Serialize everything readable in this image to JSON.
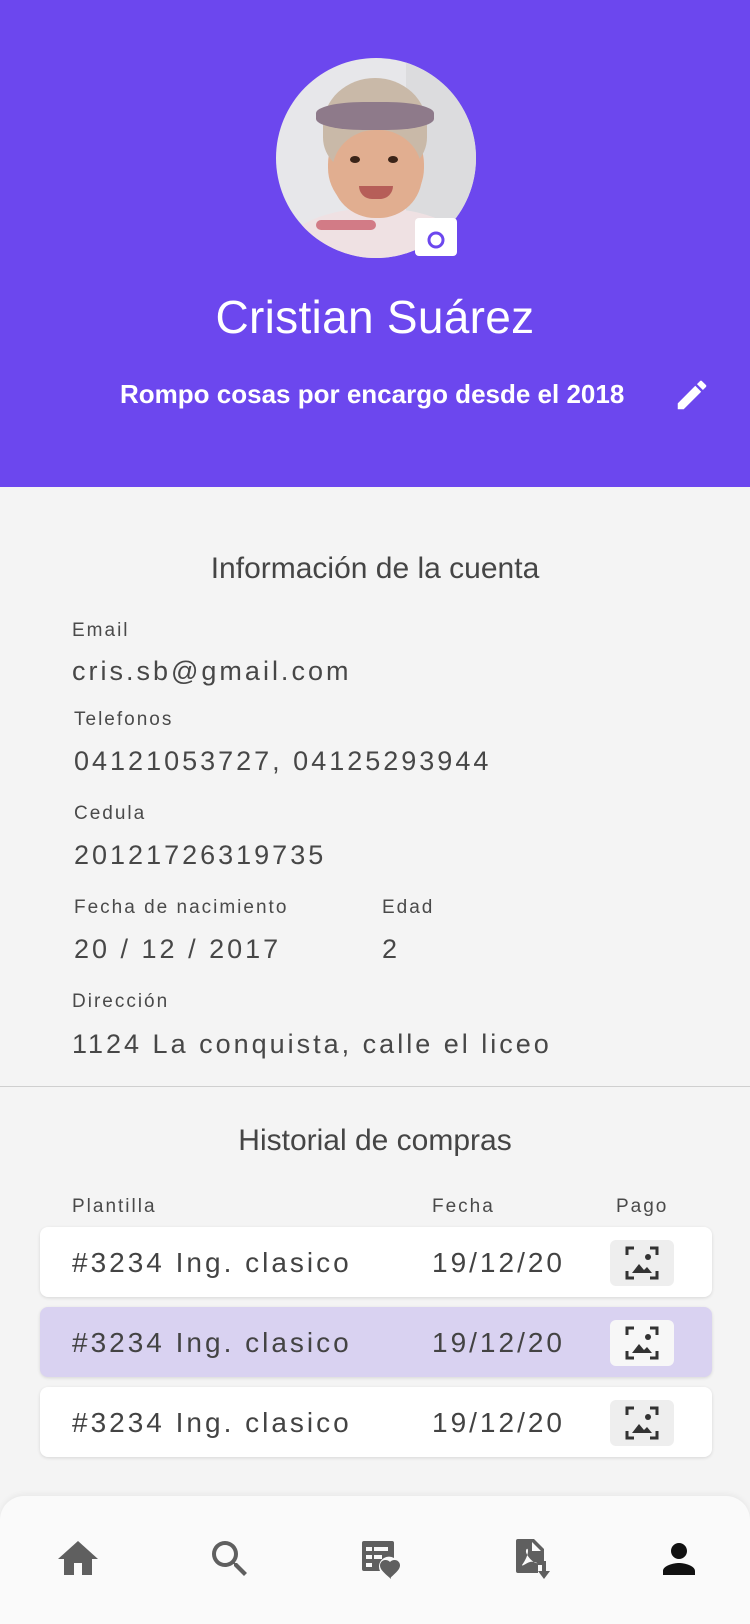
{
  "profile": {
    "name": "Cristian Suárez",
    "bio": "Rompo cosas por encargo desde el 2018"
  },
  "account": {
    "title": "Información de la cuenta",
    "email_label": "Email",
    "email": "cris.sb@gmail.com",
    "phones_label": "Telefonos",
    "phones": "04121053727, 04125293944",
    "id_label": "Cedula",
    "id": "20121726319735",
    "birth_label": "Fecha de nacimiento",
    "birth": "20 / 12 / 2017",
    "age_label": "Edad",
    "age": "2",
    "address_label": "Dirección",
    "address": "1124 La conquista, calle el liceo"
  },
  "history": {
    "title": "Historial de compras",
    "columns": [
      "Plantilla",
      "Fecha",
      "Pago"
    ],
    "rows": [
      {
        "template": "#3234 Ing. clasico",
        "date": "19/12/20",
        "highlighted": false
      },
      {
        "template": "#3234 Ing. clasico",
        "date": "19/12/20",
        "highlighted": true
      },
      {
        "template": "#3234 Ing. clasico",
        "date": "19/12/20",
        "highlighted": false
      }
    ]
  },
  "nav": {
    "items": [
      "home-icon",
      "search-icon",
      "favorites-list-icon",
      "pdf-download-icon",
      "person-icon"
    ],
    "active": "person-icon"
  },
  "colors": {
    "primary": "#6c47ee",
    "highlight_row": "#d9d2f1",
    "background": "#f4f4f4"
  }
}
